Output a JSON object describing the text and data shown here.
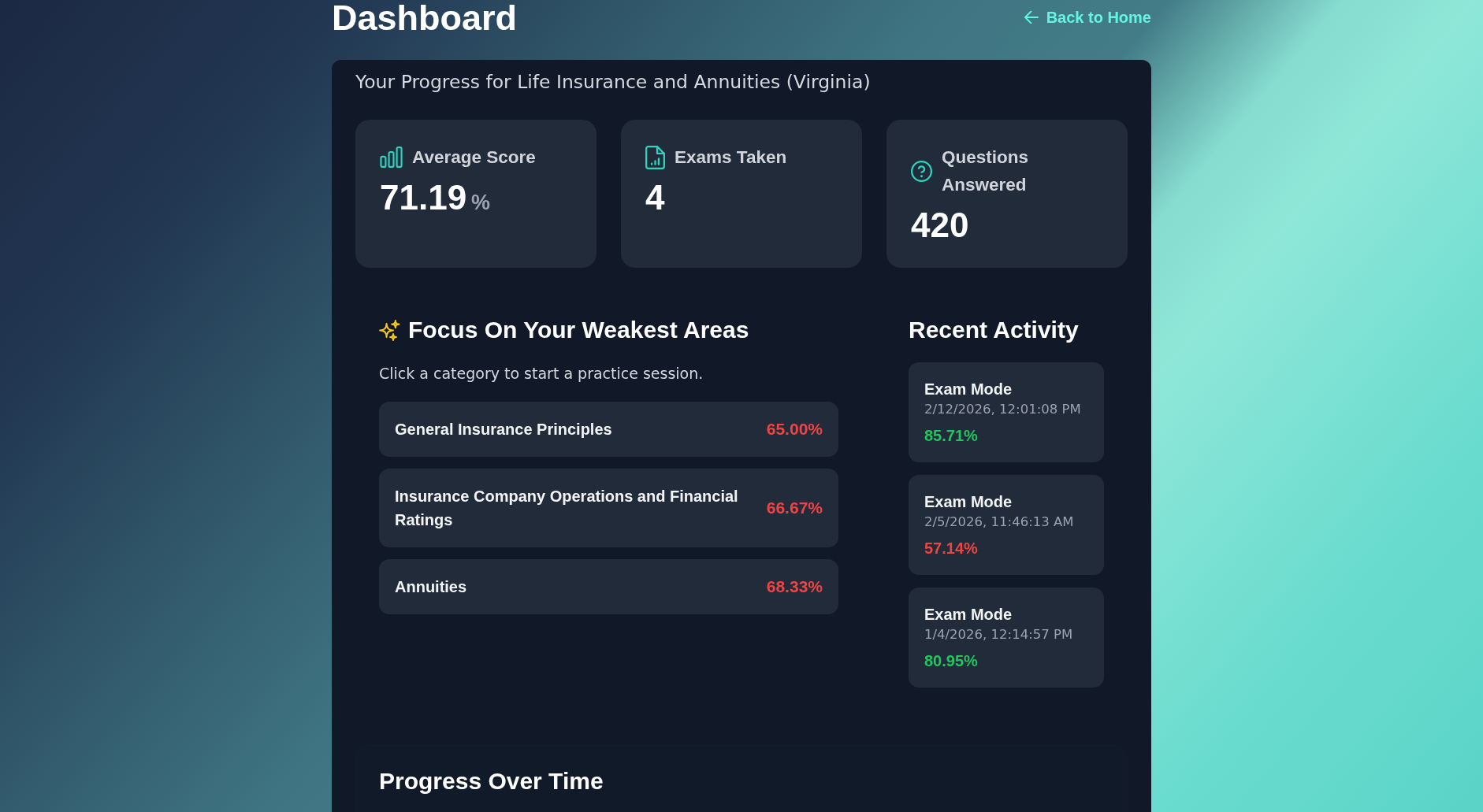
{
  "header": {
    "title": "Dashboard",
    "back_link": "Back to Home"
  },
  "panel": {
    "subtitle": "Your Progress for Life Insurance and Annuities (Virginia)"
  },
  "stats": [
    {
      "kind": "score",
      "label": "Average Score",
      "value": "71.19",
      "unit": "%"
    },
    {
      "kind": "exams",
      "label": "Exams Taken",
      "value": "4"
    },
    {
      "kind": "questions",
      "label": "Questions Answered",
      "value": "420"
    }
  ],
  "weakest_areas": {
    "title": "Focus On Your Weakest Areas",
    "description": "Click a category to start a practice session.",
    "categories": [
      {
        "name": "General Insurance Principles",
        "score": "65.00%"
      },
      {
        "name": "Insurance Company Operations and Financial Ratings",
        "score": "66.67%"
      },
      {
        "name": "Annuities",
        "score": "68.33%"
      }
    ]
  },
  "recent_activity": {
    "title": "Recent Activity",
    "items": [
      {
        "mode": "Exam Mode",
        "date": "2/12/2026, 12:01:08 PM",
        "score": "85.71%",
        "color": "#22c55e"
      },
      {
        "mode": "Exam Mode",
        "date": "2/5/2026, 11:46:13 AM",
        "score": "57.14%",
        "color": "#ef4444"
      },
      {
        "mode": "Exam Mode",
        "date": "1/4/2026, 12:14:57 PM",
        "score": "80.95%",
        "color": "#22c55e"
      }
    ]
  },
  "progress": {
    "title": "Progress Over Time"
  }
}
